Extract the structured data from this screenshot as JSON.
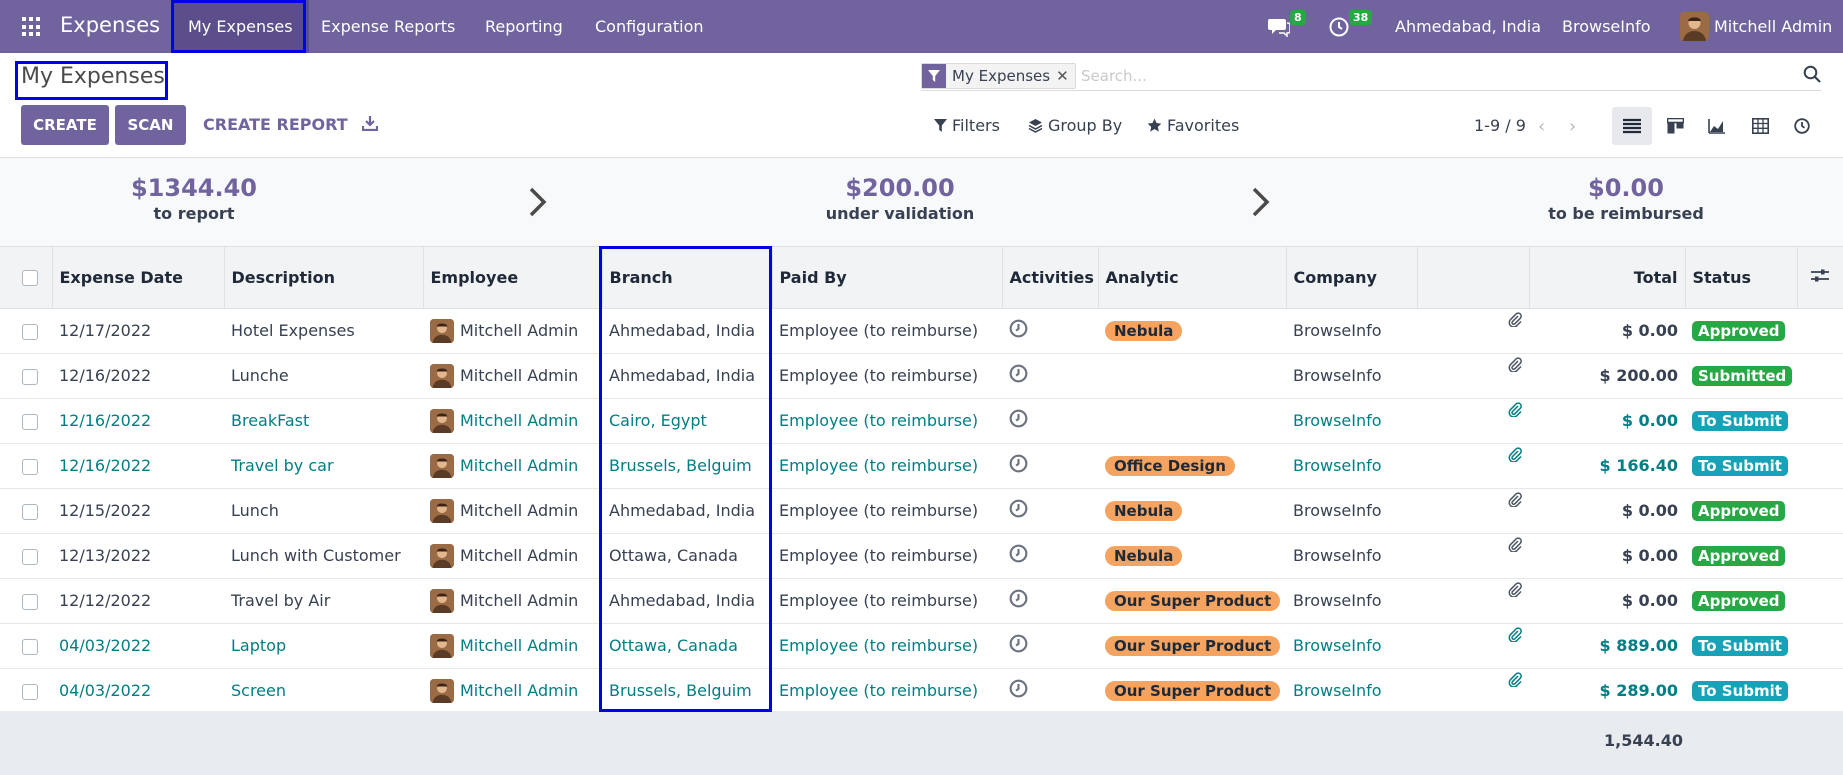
{
  "navbar": {
    "app_name": "Expenses",
    "menus": [
      "My Expenses",
      "Expense Reports",
      "Reporting",
      "Configuration"
    ],
    "messages_count": "8",
    "activities_count": "38",
    "branch": "Ahmedabad, India",
    "company": "BrowseInfo",
    "user": "Mitchell Admin"
  },
  "control_panel": {
    "title": "My Expenses",
    "create_label": "CREATE",
    "scan_label": "SCAN",
    "create_report_label": "CREATE REPORT",
    "facet_label": "My Expenses",
    "search_placeholder": "Search...",
    "filters_label": "Filters",
    "groupby_label": "Group By",
    "favorites_label": "Favorites",
    "pager": "1-9 / 9"
  },
  "summary": {
    "to_report_amount": "$1344.40",
    "to_report_label": "to report",
    "under_validation_amount": "$200.00",
    "under_validation_label": "under validation",
    "to_be_reimbursed_amount": "$0.00",
    "to_be_reimbursed_label": "to be reimbursed"
  },
  "table": {
    "columns": {
      "expense_date": "Expense Date",
      "description": "Description",
      "employee": "Employee",
      "branch": "Branch",
      "paid_by": "Paid By",
      "activities": "Activities",
      "analytic": "Analytic",
      "company": "Company",
      "total": "Total",
      "status": "Status"
    },
    "rows": [
      {
        "date": "12/17/2022",
        "description": "Hotel Expenses",
        "employee": "Mitchell Admin",
        "branch": "Ahmedabad, India",
        "paid_by": "Employee (to reimburse)",
        "analytic": "Nebula",
        "company": "BrowseInfo",
        "total": "$ 0.00",
        "status": "Approved"
      },
      {
        "date": "12/16/2022",
        "description": "Lunche",
        "employee": "Mitchell Admin",
        "branch": "Ahmedabad, India",
        "paid_by": "Employee (to reimburse)",
        "analytic": "",
        "company": "BrowseInfo",
        "total": "$ 200.00",
        "status": "Submitted"
      },
      {
        "date": "12/16/2022",
        "description": "BreakFast",
        "employee": "Mitchell Admin",
        "branch": "Cairo, Egypt",
        "paid_by": "Employee (to reimburse)",
        "analytic": "",
        "company": "BrowseInfo",
        "total": "$ 0.00",
        "status": "To Submit"
      },
      {
        "date": "12/16/2022",
        "description": "Travel by car",
        "employee": "Mitchell Admin",
        "branch": "Brussels, Belguim",
        "paid_by": "Employee (to reimburse)",
        "analytic": "Office Design",
        "company": "BrowseInfo",
        "total": "$ 166.40",
        "status": "To Submit"
      },
      {
        "date": "12/15/2022",
        "description": "Lunch",
        "employee": "Mitchell Admin",
        "branch": "Ahmedabad, India",
        "paid_by": "Employee (to reimburse)",
        "analytic": "Nebula",
        "company": "BrowseInfo",
        "total": "$ 0.00",
        "status": "Approved"
      },
      {
        "date": "12/13/2022",
        "description": "Lunch with Customer",
        "employee": "Mitchell Admin",
        "branch": "Ottawa, Canada",
        "paid_by": "Employee (to reimburse)",
        "analytic": "Nebula",
        "company": "BrowseInfo",
        "total": "$ 0.00",
        "status": "Approved"
      },
      {
        "date": "12/12/2022",
        "description": "Travel by Air",
        "employee": "Mitchell Admin",
        "branch": "Ahmedabad, India",
        "paid_by": "Employee (to reimburse)",
        "analytic": "Our Super Product",
        "company": "BrowseInfo",
        "total": "$ 0.00",
        "status": "Approved"
      },
      {
        "date": "04/03/2022",
        "description": "Laptop",
        "employee": "Mitchell Admin",
        "branch": "Ottawa, Canada",
        "paid_by": "Employee (to reimburse)",
        "analytic": "Our Super Product",
        "company": "BrowseInfo",
        "total": "$ 889.00",
        "status": "To Submit"
      },
      {
        "date": "04/03/2022",
        "description": "Screen",
        "employee": "Mitchell Admin",
        "branch": "Brussels, Belguim",
        "paid_by": "Employee (to reimburse)",
        "analytic": "Our Super Product",
        "company": "BrowseInfo",
        "total": "$ 289.00",
        "status": "To Submit"
      }
    ],
    "footer_total": "1,544.40"
  },
  "colors": {
    "brand": "#71639e",
    "link": "#017e84",
    "approved": "#28a745",
    "to_submit": "#17a2b8",
    "tag": "#f4a460",
    "highlight": "#0000e6"
  }
}
